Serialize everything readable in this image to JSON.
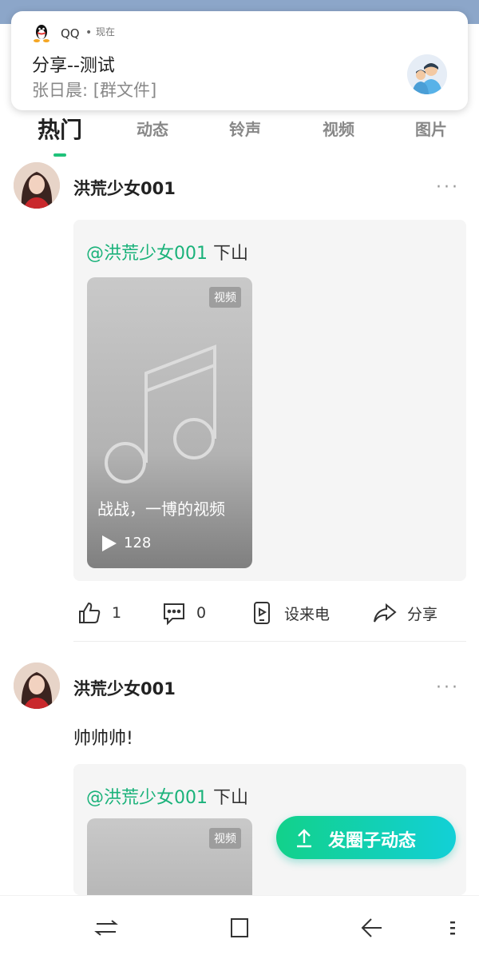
{
  "notification": {
    "app_name": "QQ",
    "separator": "•",
    "time": "现在",
    "title": "分享--测试",
    "body": "张日晨: [群文件]"
  },
  "tabs": [
    {
      "label": "热门",
      "active": true
    },
    {
      "label": "动态",
      "active": false
    },
    {
      "label": "铃声",
      "active": false
    },
    {
      "label": "视频",
      "active": false
    },
    {
      "label": "图片",
      "active": false
    }
  ],
  "posts": [
    {
      "username": "洪荒少女001",
      "more": "···",
      "card": {
        "mention": "@洪荒少女001",
        "text": "下山",
        "video_badge": "视频",
        "video_title": "战战，一博的视频",
        "play_count": "128"
      },
      "actions": {
        "likes": "1",
        "comments": "0",
        "set_ringtone": "设来电",
        "share": "分享"
      }
    },
    {
      "username": "洪荒少女001",
      "more": "···",
      "text": "帅帅帅!",
      "card": {
        "mention": "@洪荒少女001",
        "text": "下山",
        "video_badge": "视频"
      }
    }
  ],
  "fab": {
    "label": "发圈子动态"
  },
  "colors": {
    "accent": "#1ab27a",
    "fab_start": "#12d18a",
    "fab_end": "#12d0d7"
  },
  "icons": {
    "qq": "qq-penguin-icon",
    "like": "thumbs-up-icon",
    "comment": "comment-icon",
    "ringtone": "phone-ringtone-icon",
    "share": "share-icon",
    "upload": "upload-arrow-icon",
    "nav": [
      "switch-icon",
      "home-square-icon",
      "back-icon",
      "menu-icon"
    ]
  }
}
